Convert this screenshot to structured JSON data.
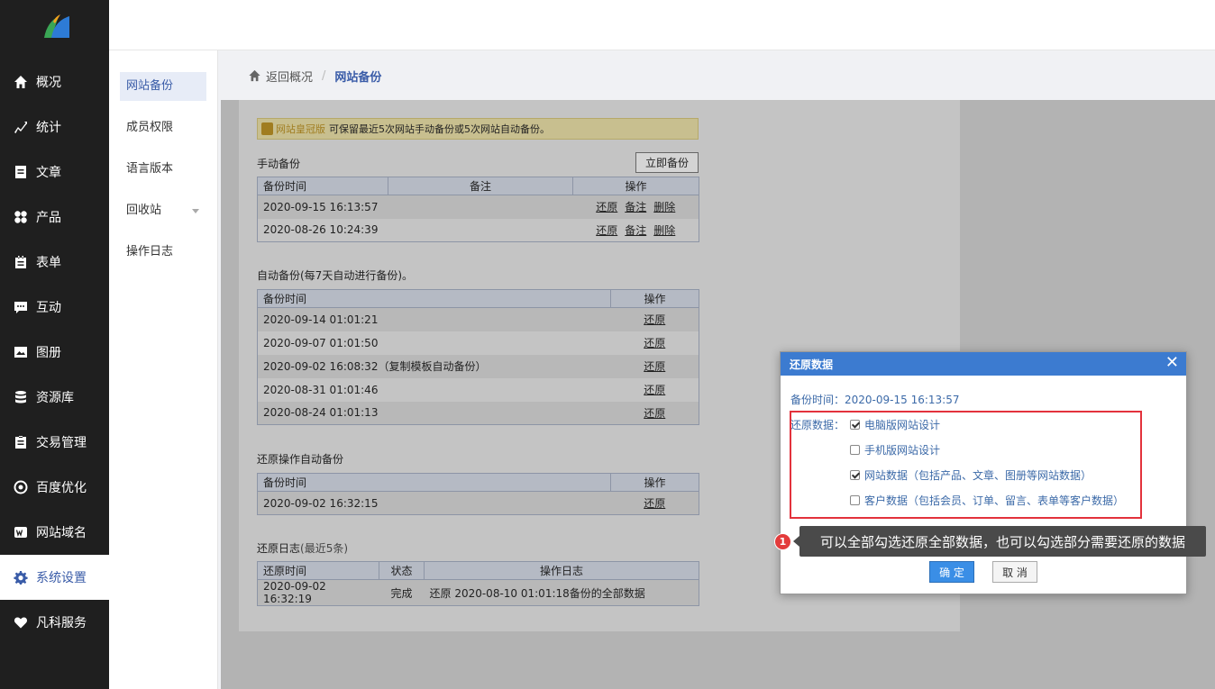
{
  "nav": {
    "items": [
      {
        "label": "概况",
        "icon": "home-icon"
      },
      {
        "label": "统计",
        "icon": "stats-icon"
      },
      {
        "label": "文章",
        "icon": "article-icon"
      },
      {
        "label": "产品",
        "icon": "product-icon"
      },
      {
        "label": "表单",
        "icon": "form-icon"
      },
      {
        "label": "互动",
        "icon": "chat-icon"
      },
      {
        "label": "图册",
        "icon": "album-icon"
      },
      {
        "label": "资源库",
        "icon": "database-icon"
      },
      {
        "label": "交易管理",
        "icon": "trade-icon"
      },
      {
        "label": "百度优化",
        "icon": "seo-icon"
      },
      {
        "label": "网站域名",
        "icon": "domain-icon"
      },
      {
        "label": "系统设置",
        "icon": "gear-icon"
      },
      {
        "label": "凡科服务",
        "icon": "heart-icon"
      }
    ],
    "active_index": 11
  },
  "subnav": {
    "items": [
      {
        "label": "网站备份"
      },
      {
        "label": "成员权限"
      },
      {
        "label": "语言版本"
      },
      {
        "label": "回收站"
      },
      {
        "label": "操作日志"
      }
    ]
  },
  "breadcrumb": {
    "back": "返回概况",
    "sep": "/",
    "current": "网站备份"
  },
  "notice": {
    "vip": "网站皇冠版",
    "text": "可保留最近5次网站手动备份或5次网站自动备份。"
  },
  "manual": {
    "title": "手动备份",
    "button": "立即备份",
    "headers": [
      "备份时间",
      "备注",
      "操作"
    ],
    "rows": [
      {
        "time": "2020-09-15 16:13:57",
        "note": "",
        "actions": [
          "还原",
          "备注",
          "删除"
        ]
      },
      {
        "time": "2020-08-26 10:24:39",
        "note": "",
        "actions": [
          "还原",
          "备注",
          "删除"
        ]
      }
    ]
  },
  "auto": {
    "title": "自动备份(每7天自动进行备份)。",
    "headers": [
      "备份时间",
      "操作"
    ],
    "rows": [
      {
        "time": "2020-09-14 01:01:21",
        "action": "还原"
      },
      {
        "time": "2020-09-07 01:01:50",
        "action": "还原"
      },
      {
        "time": "2020-09-02 16:08:32（复制模板自动备份）",
        "action": "还原"
      },
      {
        "time": "2020-08-31 01:01:46",
        "action": "还原"
      },
      {
        "time": "2020-08-24 01:01:13",
        "action": "还原"
      }
    ]
  },
  "restore_auto": {
    "title": "还原操作自动备份",
    "headers": [
      "备份时间",
      "操作"
    ],
    "rows": [
      {
        "time": "2020-09-02 16:32:15",
        "action": "还原"
      }
    ]
  },
  "restore_log": {
    "title": "还原日志",
    "title_note": "(最近5条)",
    "headers": [
      "还原时间",
      "状态",
      "操作日志"
    ],
    "rows": [
      {
        "time": "2020-09-02 16:32:19",
        "status": "完成",
        "log": "还原 2020-08-10 01:01:18备份的全部数据"
      }
    ]
  },
  "modal": {
    "title": "还原数据",
    "backup_time_label": "备份时间：",
    "backup_time": "2020-09-15 16:13:57",
    "restore_label": "还原数据：",
    "options": [
      {
        "label": "电脑版网站设计",
        "checked": true
      },
      {
        "label": "手机版网站设计",
        "checked": false
      },
      {
        "label": "网站数据（包括产品、文章、图册等网站数据）",
        "checked": true
      },
      {
        "label": "客户数据（包括会员、订单、留言、表单等客户数据）",
        "checked": false
      }
    ],
    "ok": "确 定",
    "cancel": "取 消"
  },
  "tooltip": {
    "number": "1",
    "text": "可以全部勾选还原全部数据，也可以勾选部分需要还原的数据"
  }
}
